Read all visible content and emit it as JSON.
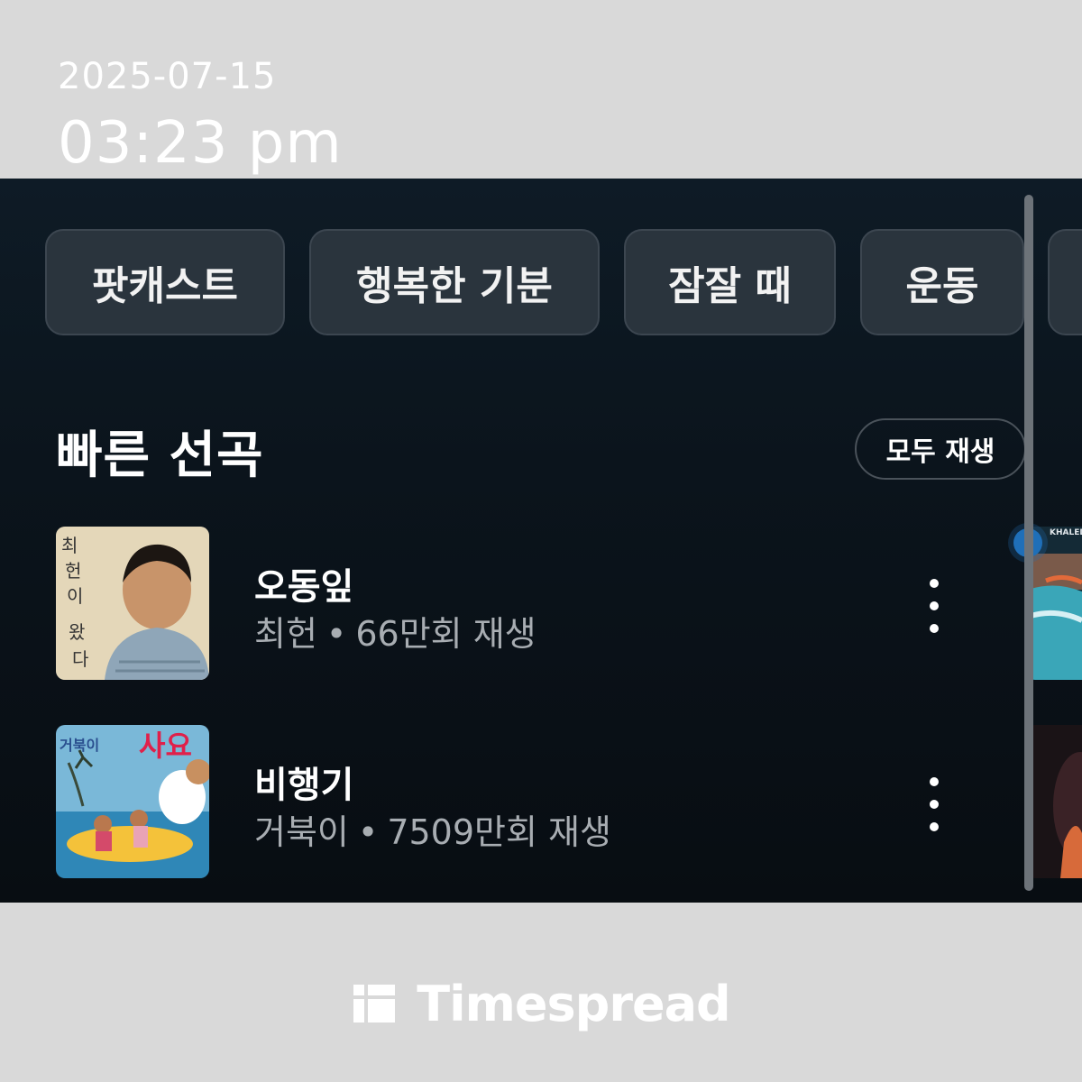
{
  "overlay": {
    "date": "2025-07-15",
    "time": "03:23 pm",
    "brand": "Timespread"
  },
  "chips": [
    {
      "label": "팟캐스트"
    },
    {
      "label": "행복한 기분"
    },
    {
      "label": "잠잘 때"
    },
    {
      "label": "운동"
    }
  ],
  "quick_picks": {
    "title": "빠른 선곡",
    "play_all_label": "모두 재생",
    "tracks": [
      {
        "title": "오동잎",
        "artist": "최헌",
        "separator": "•",
        "plays": "66만회 재생",
        "art_text": "최헌이 왔다"
      },
      {
        "title": "비행기",
        "artist": "거북이",
        "separator": "•",
        "plays": "7509만회 재생",
        "art_text": "거북이 사요!!"
      }
    ],
    "peek_label": "KHALED"
  },
  "icons": {
    "more": "more-vertical-icon",
    "brand": "timespread-logo-icon"
  },
  "colors": {
    "panel_bg": "#0b141c",
    "chip_bg": "#2a343d",
    "meta_text": "#a8adb2",
    "accent": "#1f6fb8",
    "overlay_bg": "#d9d9d9"
  }
}
